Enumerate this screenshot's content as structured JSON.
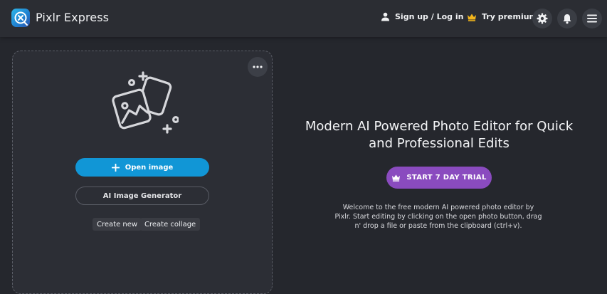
{
  "header": {
    "app_title": "Pixlr Express",
    "signup_label": "Sign up / Log in",
    "premium_label": "Try premium",
    "icons": [
      "user-icon",
      "crown-icon",
      "gear-icon",
      "bell-icon",
      "hamburger-menu-icon"
    ]
  },
  "panel": {
    "more_icon": "more-horizontal-icon",
    "hero_icon": "photos-icon",
    "open_image_label": "Open image",
    "ai_generator_label": "AI Image Generator",
    "create_new_label": "Create new",
    "create_collage_label": "Create collage"
  },
  "promo": {
    "headline": "Modern AI Powered Photo Editor for Quick and Professional Edits",
    "trial_label": "START 7 DAY TRIAL",
    "description": "Welcome to the free modern AI powered photo editor by Pixlr. Start editing by clicking on the open photo button, drag n' drop a file or paste from the clipboard (ctrl+v)."
  },
  "colors": {
    "background": "#25272d",
    "topbar": "#2b2d33",
    "open_button": "#1196d6",
    "trial_button": "#8a4bbf",
    "crown": "#f2b51c"
  }
}
